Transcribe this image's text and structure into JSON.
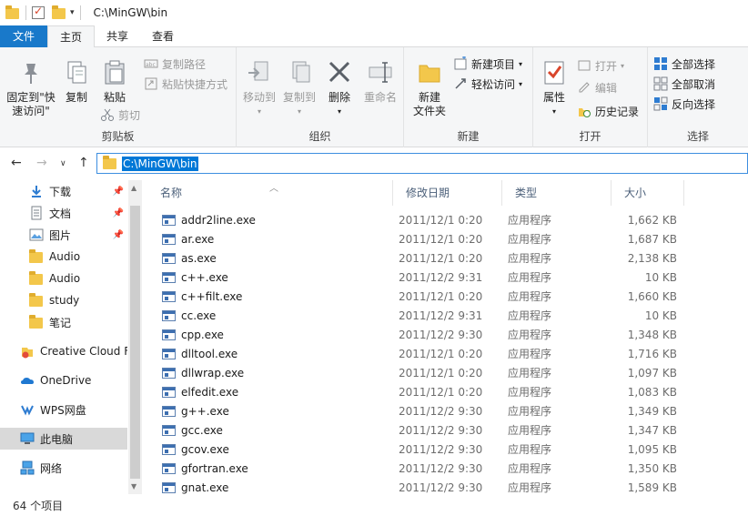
{
  "window": {
    "title": "C:\\MinGW\\bin"
  },
  "ribbon_tabs": [
    {
      "label": "文件"
    },
    {
      "label": "主页"
    },
    {
      "label": "共享"
    },
    {
      "label": "查看"
    }
  ],
  "ribbon": {
    "clipboard": {
      "pin_label": "固定到\"快\n速访问\"",
      "copy_label": "复制",
      "paste_label": "粘贴",
      "copy_path_label": "复制路径",
      "paste_shortcut_label": "粘贴快捷方式",
      "cut_label": "剪切",
      "group_label": "剪贴板"
    },
    "organize": {
      "move_to_label": "移动到",
      "copy_to_label": "复制到",
      "delete_label": "删除",
      "rename_label": "重命名",
      "group_label": "组织"
    },
    "new": {
      "new_folder_label": "新建\n文件夹",
      "new_item_label": "新建项目",
      "easy_access_label": "轻松访问",
      "group_label": "新建"
    },
    "open": {
      "properties_label": "属性",
      "open_label": "打开",
      "edit_label": "编辑",
      "history_label": "历史记录",
      "group_label": "打开"
    },
    "select": {
      "select_all_label": "全部选择",
      "select_none_label": "全部取消",
      "invert_label": "反向选择",
      "group_label": "选择"
    }
  },
  "address": {
    "path": "C:\\MinGW\\bin"
  },
  "nav": {
    "items": [
      {
        "label": "下载",
        "pinned": true
      },
      {
        "label": "文档",
        "pinned": true
      },
      {
        "label": "图片",
        "pinned": true
      },
      {
        "label": "Audio"
      },
      {
        "label": "Audio"
      },
      {
        "label": "study"
      },
      {
        "label": "笔记"
      },
      {
        "label": "Creative Cloud F"
      },
      {
        "label": "OneDrive"
      },
      {
        "label": "WPS网盘"
      },
      {
        "label": "此电脑"
      },
      {
        "label": "网络"
      }
    ]
  },
  "columns": {
    "name": "名称",
    "date": "修改日期",
    "type": "类型",
    "size": "大小"
  },
  "files": [
    {
      "name": "addr2line.exe",
      "date": "2011/12/1 0:20",
      "type": "应用程序",
      "size": "1,662 KB"
    },
    {
      "name": "ar.exe",
      "date": "2011/12/1 0:20",
      "type": "应用程序",
      "size": "1,687 KB"
    },
    {
      "name": "as.exe",
      "date": "2011/12/1 0:20",
      "type": "应用程序",
      "size": "2,138 KB"
    },
    {
      "name": "c++.exe",
      "date": "2011/12/2 9:31",
      "type": "应用程序",
      "size": "10 KB"
    },
    {
      "name": "c++filt.exe",
      "date": "2011/12/1 0:20",
      "type": "应用程序",
      "size": "1,660 KB"
    },
    {
      "name": "cc.exe",
      "date": "2011/12/2 9:31",
      "type": "应用程序",
      "size": "10 KB"
    },
    {
      "name": "cpp.exe",
      "date": "2011/12/2 9:30",
      "type": "应用程序",
      "size": "1,348 KB"
    },
    {
      "name": "dlltool.exe",
      "date": "2011/12/1 0:20",
      "type": "应用程序",
      "size": "1,716 KB"
    },
    {
      "name": "dllwrap.exe",
      "date": "2011/12/1 0:20",
      "type": "应用程序",
      "size": "1,097 KB"
    },
    {
      "name": "elfedit.exe",
      "date": "2011/12/1 0:20",
      "type": "应用程序",
      "size": "1,083 KB"
    },
    {
      "name": "g++.exe",
      "date": "2011/12/2 9:30",
      "type": "应用程序",
      "size": "1,349 KB"
    },
    {
      "name": "gcc.exe",
      "date": "2011/12/2 9:30",
      "type": "应用程序",
      "size": "1,347 KB"
    },
    {
      "name": "gcov.exe",
      "date": "2011/12/2 9:30",
      "type": "应用程序",
      "size": "1,095 KB"
    },
    {
      "name": "gfortran.exe",
      "date": "2011/12/2 9:30",
      "type": "应用程序",
      "size": "1,350 KB"
    },
    {
      "name": "gnat.exe",
      "date": "2011/12/2 9:30",
      "type": "应用程序",
      "size": "1,589 KB"
    }
  ],
  "status": {
    "item_count": "64 个项目"
  },
  "colors": {
    "accent": "#1979ca",
    "selection": "#0078d7"
  }
}
